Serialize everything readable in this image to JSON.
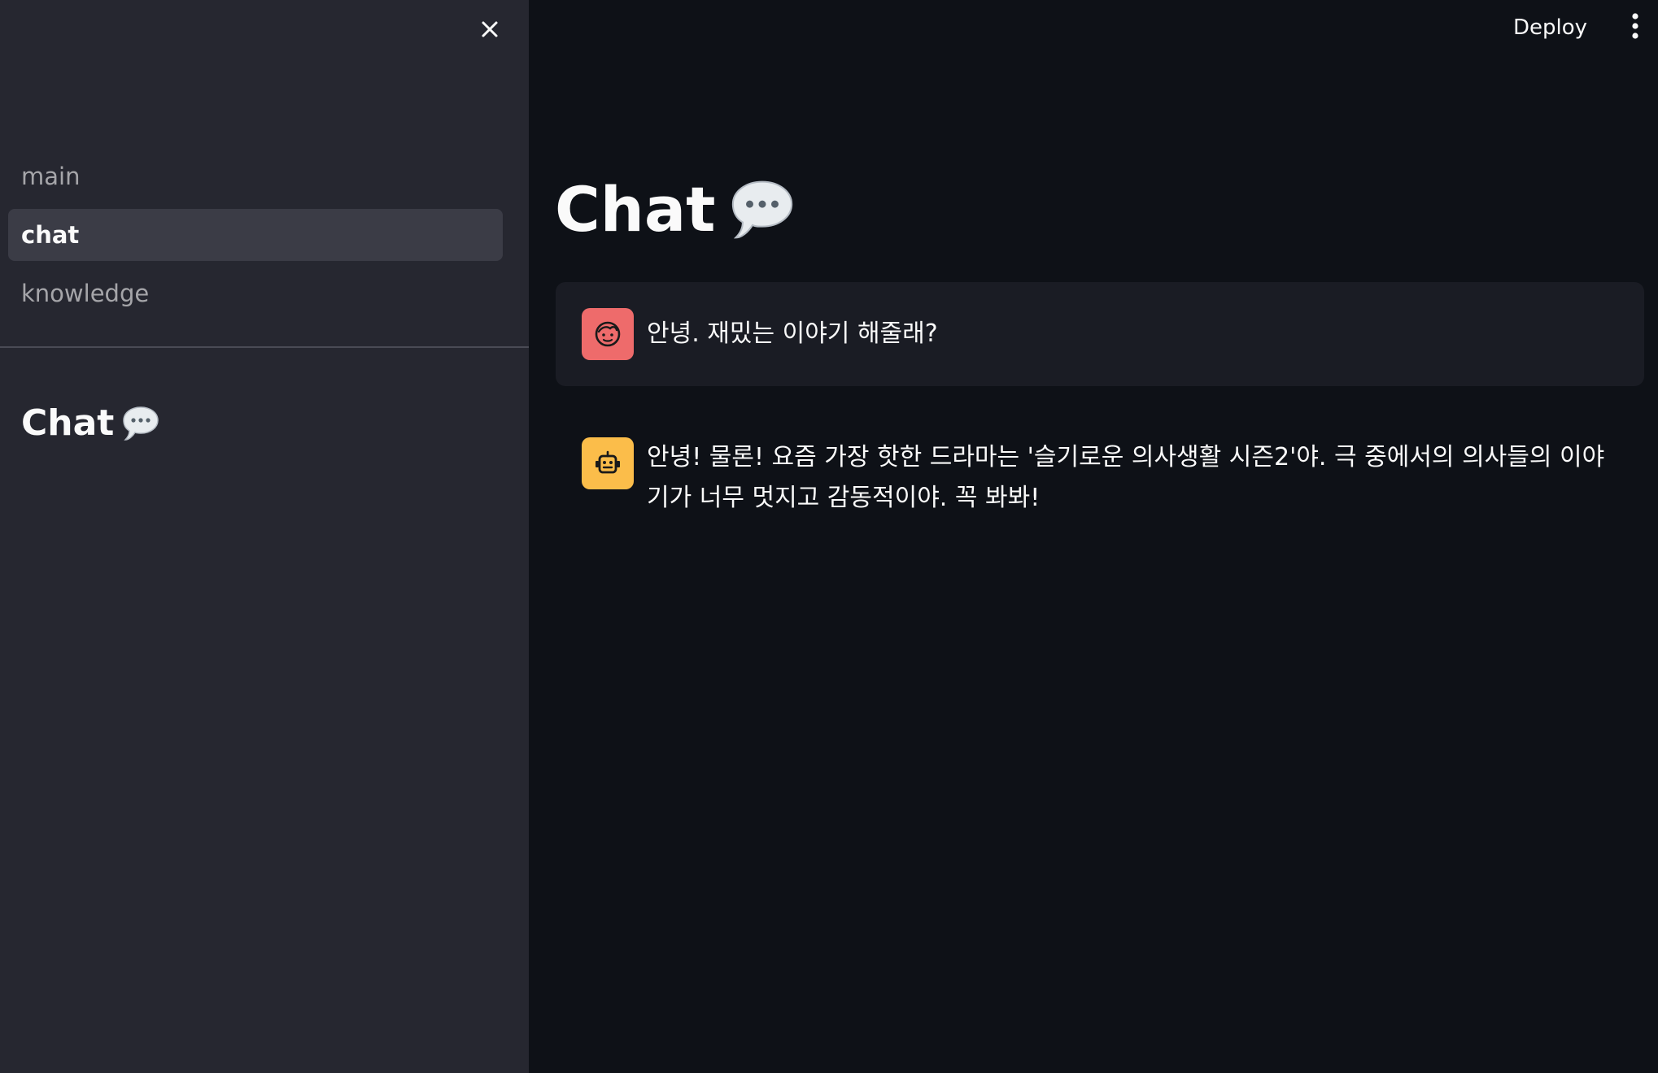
{
  "header": {
    "deploy_label": "Deploy"
  },
  "sidebar": {
    "nav_items": [
      {
        "label": "main",
        "active": false
      },
      {
        "label": "chat",
        "active": true
      },
      {
        "label": "knowledge",
        "active": false
      }
    ],
    "title": "Chat",
    "title_icon": "speech-balloon-icon"
  },
  "main": {
    "title": "Chat",
    "title_icon": "speech-balloon-icon",
    "messages": [
      {
        "role": "user",
        "avatar_icon": "face-icon",
        "text": "안녕. 재밌는 이야기 해줄래?"
      },
      {
        "role": "assistant",
        "avatar_icon": "robot-icon",
        "text": "안녕! 물론! 요즘 가장 핫한 드라마는 '슬기로운 의사생활 시즌2'야. 극 중에서의 의사들의 이야기가 너무 멋지고 감동적이야. 꼭 봐봐!"
      }
    ]
  },
  "colors": {
    "background": "#0e1117",
    "sidebar": "#262730",
    "user_avatar": "#ee6b6b",
    "assistant_avatar": "#fbbd4a",
    "user_message_bg": "#1a1c24"
  }
}
